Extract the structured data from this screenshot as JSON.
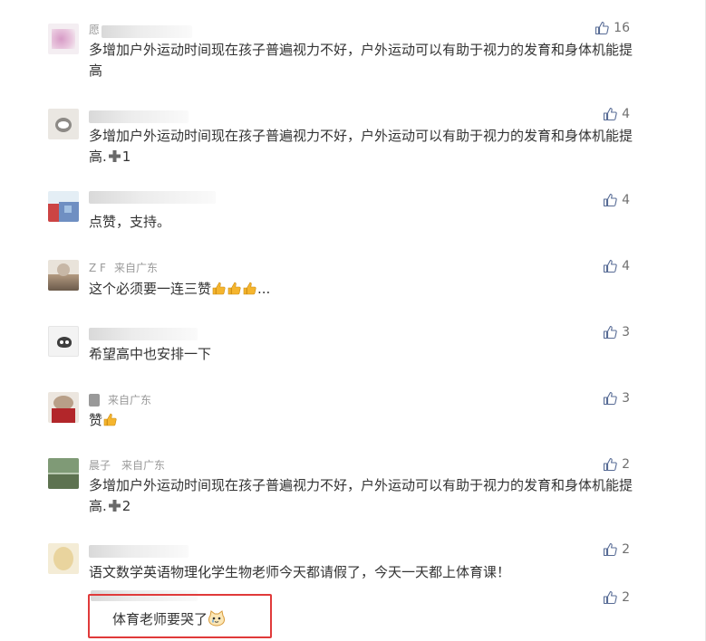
{
  "comments": [
    {
      "name_fragment": "愿",
      "source": "",
      "text": "多增加户外运动时间现在孩子普遍视力不好，户外运动可以有助于视力的发育和身体机能提高",
      "likes": "16"
    },
    {
      "name_fragment": "",
      "source": "",
      "text": "多增加户外运动时间现在孩子普遍视力不好，户外运动可以有助于视力的发育和身体机能提高.",
      "suffix": "1",
      "likes": "4"
    },
    {
      "name_fragment": "",
      "source": "",
      "text": "点赞，支持。",
      "likes": "4"
    },
    {
      "name_fragment": "Z F",
      "source": "来自广东",
      "text": "这个必须要一连三赞",
      "suffix": "...",
      "likes": "4"
    },
    {
      "name_fragment": "",
      "source": "",
      "text": "希望高中也安排一下",
      "likes": "3"
    },
    {
      "name_fragment": "",
      "source": "来自广东",
      "text": "赞",
      "likes": "3"
    },
    {
      "name_fragment": "晨子",
      "source": "来自广东",
      "text": "多增加户外运动时间现在孩子普遍视力不好，户外运动可以有助于视力的发育和身体机能提高.",
      "suffix": "2",
      "likes": "2"
    },
    {
      "name_fragment": "",
      "source": "",
      "text": "语文数学英语物理化学生物老师今天都请假了，今天一天都上体育课！",
      "likes": "2"
    }
  ],
  "reply": {
    "text": "体育老师要哭了",
    "likes": "2"
  },
  "colors": {
    "highlight_border": "#e03a3a",
    "text": "#333333",
    "meta": "#9a9a9a"
  }
}
